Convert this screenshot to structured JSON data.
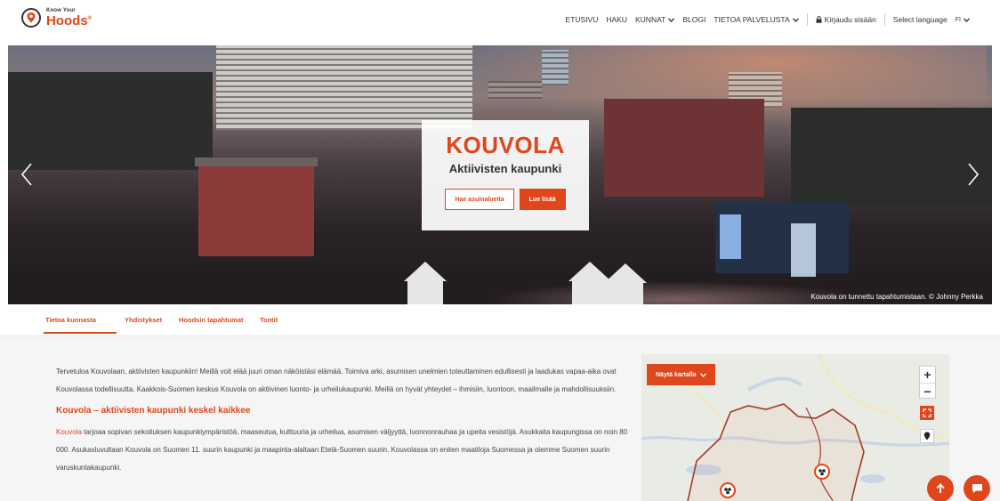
{
  "header": {
    "logo": {
      "small": "Know Your",
      "big": "Hoods",
      "mark": "®"
    },
    "nav": [
      {
        "label": "ETUSIVU",
        "dropdown": false
      },
      {
        "label": "HAKU",
        "dropdown": false
      },
      {
        "label": "KUNNAT",
        "dropdown": true
      },
      {
        "label": "BLOGI",
        "dropdown": false
      },
      {
        "label": "TIETOA PALVELUSTA",
        "dropdown": true
      }
    ],
    "login_label": "Kirjaudu sisään",
    "language_label": "Select language",
    "language_code": "FI"
  },
  "hero": {
    "title": "KOUVOLA",
    "subtitle": "Aktiivisten kaupunki",
    "button_search": "Hae asuinalueita",
    "button_more": "Lue lisää",
    "caption": "Kouvola on tunnettu tapahtumistaan. © Johnny Perkka"
  },
  "tabs": [
    {
      "label": "Tietoa kunnasta",
      "active": true
    },
    {
      "label": "Yhdistykset",
      "active": false
    },
    {
      "label": "Hoodsin tapahtumat",
      "active": false
    },
    {
      "label": "Tontit",
      "active": false
    }
  ],
  "content": {
    "intro": "Tervetuloa Kouvolaan, aktiivisten kaupunkiin! Meillä voit elää juuri oman näköistäsi elämää. Toimiva arki, asumisen unelmien toteuttaminen edullisesti ja laadukas vapaa-aika ovat Kouvolassa todellisuutta. Kaakkois-Suomen keskus Kouvola on aktiivinen luonto- ja urheilukaupunki. Meillä on hyvät yhteydet – ihmisiin, luontoon, maailmalle ja mahdollisuuksiin.",
    "heading": "Kouvola – aktiivisten kaupunki keskel kaikkee",
    "link": "Kouvola",
    "body": " tarjoaa sopivan sekoituksen kaupunkiympäristöä, maaseutua, kulttuuria ja urheilua, asumisen väljyyttä, luonnonrauhaa ja upeita vesistöjä. Asukkaita kaupungissa on noin 80 000. Asukasluvultaan Kouvola on Suomen 11. suurin kaupunki ja maapinta-alaltaan Etelä-Suomen suurin. Kouvolassa on eniten maatiloja Suomessa ja olemme Suomen suurin varuskuntakaupunki."
  },
  "map": {
    "button_label": "Näytä kartalla",
    "zoom_in": "+",
    "zoom_out": "−"
  },
  "colors": {
    "accent": "#e0461c"
  },
  "icons": [
    "location-pin-icon",
    "chevron-down-icon",
    "lock-icon",
    "arrow-left-icon",
    "arrow-right-icon",
    "fullscreen-icon",
    "marker-icon",
    "arrow-up-icon",
    "chat-icon"
  ]
}
